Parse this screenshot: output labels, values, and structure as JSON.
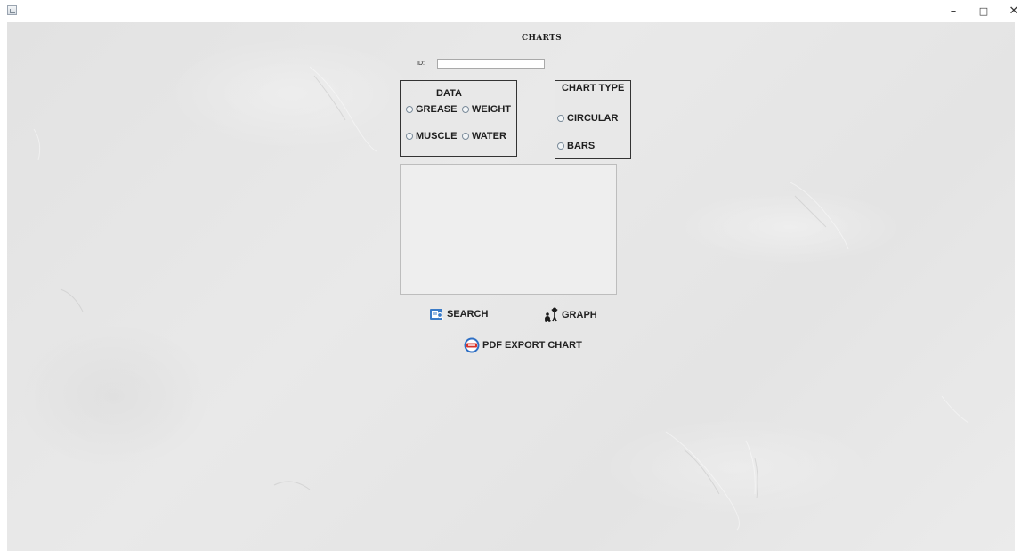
{
  "window": {
    "minimize_glyph": "–",
    "maximize_glyph": "□",
    "close_glyph": "✕"
  },
  "form": {
    "title": "CHARTS",
    "id_label": "ID:",
    "id_value": ""
  },
  "data_group": {
    "heading": "DATA",
    "options": [
      "GREASE",
      "WEIGHT",
      "MUSCLE",
      "WATER"
    ],
    "selected": null
  },
  "chart_type_group": {
    "heading": "CHART TYPE",
    "options": [
      "CIRCULAR",
      "BARS"
    ],
    "selected": null
  },
  "actions": {
    "search_label": "SEARCH",
    "graph_label": "GRAPH",
    "pdf_export_label": "PDF EXPORT CHART"
  },
  "icons": {
    "app": "java-app-icon",
    "search": "search-document-icon",
    "graph": "fitness-people-icon",
    "pdf": "pdf-export-icon"
  }
}
